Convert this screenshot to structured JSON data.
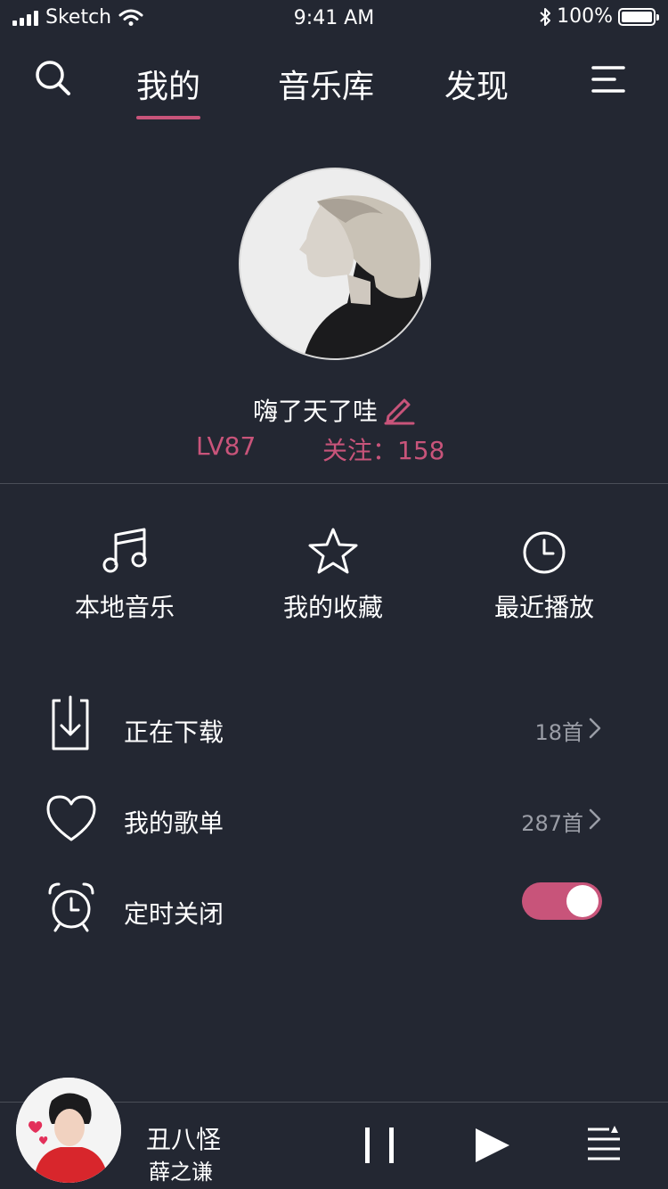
{
  "status_bar": {
    "carrier": "Sketch",
    "time": "9:41 AM",
    "battery": "100%",
    "battery_level": 1.0
  },
  "nav": {
    "tabs": [
      {
        "label": "我的",
        "active": true
      },
      {
        "label": "音乐库",
        "active": false
      },
      {
        "label": "发现",
        "active": false
      }
    ]
  },
  "profile": {
    "name": "嗨了天了哇",
    "level": "LV87",
    "following": "关注：158"
  },
  "shortcuts": [
    {
      "label": "本地音乐",
      "icon": "music-note-icon"
    },
    {
      "label": "我的收藏",
      "icon": "star-icon"
    },
    {
      "label": "最近播放",
      "icon": "clock-icon"
    }
  ],
  "list": [
    {
      "label": "正在下载",
      "count": "18首",
      "icon": "download-icon"
    },
    {
      "label": "我的歌单",
      "count": "287首",
      "icon": "heart-icon"
    },
    {
      "label": "定时关闭",
      "icon": "alarm-clock-icon",
      "toggle_on": true
    }
  ],
  "player": {
    "title": "丑八怪",
    "artist": "薛之谦"
  },
  "colors": {
    "background": "#232732",
    "accent": "#c8547a",
    "muted_text": "#9a9da6"
  }
}
